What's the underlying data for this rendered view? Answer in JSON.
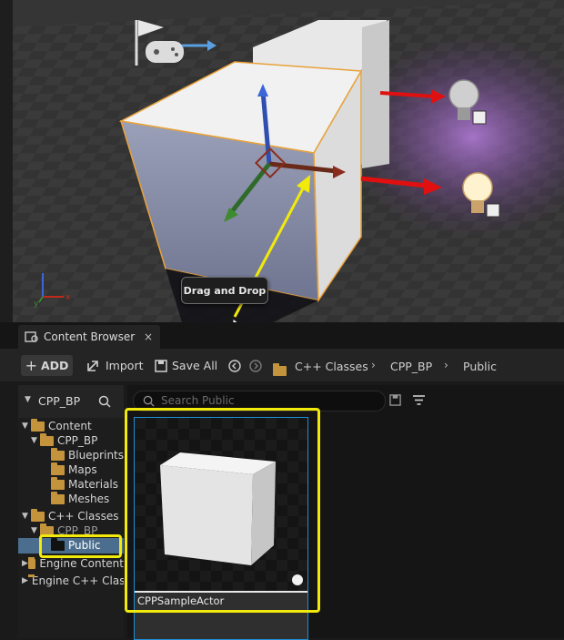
{
  "viewport": {
    "tooltip": "Drag and Drop",
    "axis_x": "x",
    "axis_y": "y"
  },
  "tab": {
    "label": "Content Browser",
    "close": "×"
  },
  "toolbar": {
    "add_label": "ADD",
    "import_label": "Import",
    "save_label": "Save All",
    "breadcrumbs": [
      "C++ Classes",
      "CPP_BP",
      "Public"
    ]
  },
  "sidebar": {
    "title": "CPP_BP",
    "items": [
      {
        "label": "Content"
      },
      {
        "label": "CPP_BP"
      },
      {
        "label": "Blueprints"
      },
      {
        "label": "Maps"
      },
      {
        "label": "Materials"
      },
      {
        "label": "Meshes"
      },
      {
        "label": "C++ Classes"
      },
      {
        "label": "CPP_BP"
      },
      {
        "label": "Public"
      },
      {
        "label": "Engine Content"
      },
      {
        "label": "Engine C++ Classes"
      }
    ]
  },
  "search": {
    "placeholder": "Search Public"
  },
  "asset": {
    "name": "CPPSampleActor"
  },
  "colors": {
    "highlight": "#f2ea0a",
    "selection": "#1d8fd6",
    "folder": "#c4943d"
  }
}
